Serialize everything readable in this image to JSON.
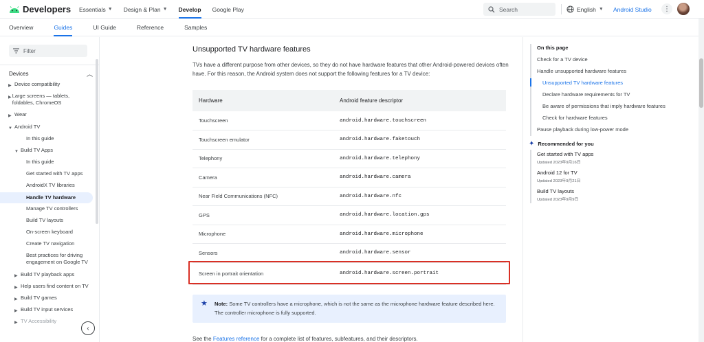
{
  "header": {
    "brand": "Developers",
    "nav": [
      {
        "label": "Essentials",
        "dropdown": true
      },
      {
        "label": "Design & Plan",
        "dropdown": true
      },
      {
        "label": "Develop",
        "dropdown": false,
        "active": true
      },
      {
        "label": "Google Play",
        "dropdown": false
      }
    ],
    "search_placeholder": "Search",
    "language": "English",
    "studio_link": "Android Studio"
  },
  "subnav": {
    "tabs": [
      {
        "label": "Overview"
      },
      {
        "label": "Guides",
        "active": true
      },
      {
        "label": "UI Guide"
      },
      {
        "label": "Reference"
      },
      {
        "label": "Samples"
      }
    ]
  },
  "sidebar": {
    "filter_placeholder": "Filter",
    "section": "Devices",
    "items": [
      {
        "label": "Device compatibility",
        "arrow": "right"
      },
      {
        "label": "Large screens — tablets, foldables, ChromeOS",
        "arrow": "right"
      },
      {
        "label": "Wear",
        "arrow": "right"
      },
      {
        "label": "Android TV",
        "arrow": "down"
      },
      {
        "label": "In this guide",
        "arrow": ""
      },
      {
        "label": "Build TV Apps",
        "arrow": "down"
      },
      {
        "label": "In this guide",
        "arrow": ""
      },
      {
        "label": "Get started with TV apps",
        "arrow": ""
      },
      {
        "label": "AndroidX TV libraries",
        "arrow": ""
      },
      {
        "label": "Handle TV hardware",
        "arrow": "",
        "active": true
      },
      {
        "label": "Manage TV controllers",
        "arrow": ""
      },
      {
        "label": "Build TV layouts",
        "arrow": ""
      },
      {
        "label": "On-screen keyboard",
        "arrow": ""
      },
      {
        "label": "Create TV navigation",
        "arrow": ""
      },
      {
        "label": "Best practices for driving engagement on Google TV",
        "arrow": ""
      },
      {
        "label": "Build TV playback apps",
        "arrow": "right"
      },
      {
        "label": "Help users find content on TV",
        "arrow": "right"
      },
      {
        "label": "Build TV games",
        "arrow": "right"
      },
      {
        "label": "Build TV input services",
        "arrow": "right"
      },
      {
        "label": "TV Accessibility",
        "arrow": "right",
        "muted": true
      }
    ]
  },
  "content": {
    "heading": "Unsupported TV hardware features",
    "intro": "TVs have a different purpose from other devices, so they do not have hardware features that other Android-powered devices often have. For this reason, the Android system does not support the following features for a TV device:",
    "table": {
      "headers": [
        "Hardware",
        "Android feature descriptor"
      ],
      "rows": [
        [
          "Touchscreen",
          "android.hardware.touchscreen"
        ],
        [
          "Touchscreen emulator",
          "android.hardware.faketouch"
        ],
        [
          "Telephony",
          "android.hardware.telephony"
        ],
        [
          "Camera",
          "android.hardware.camera"
        ],
        [
          "Near Field Communications (NFC)",
          "android.hardware.nfc"
        ],
        [
          "GPS",
          "android.hardware.location.gps"
        ],
        [
          "Microphone",
          "android.hardware.microphone"
        ],
        [
          "Sensors",
          "android.hardware.sensor"
        ],
        [
          "Screen in portrait orientation",
          "android.hardware.screen.portrait"
        ]
      ]
    },
    "note_label": "Note:",
    "note_text": " Some TV controllers have a microphone, which is not the same as the microphone hardware feature described here. The controller microphone is fully supported.",
    "see_prefix": "See the ",
    "see_link": "Features reference",
    "see_suffix": " for a complete list of features, subfeatures, and their descriptors."
  },
  "toc": {
    "heading": "On this page",
    "items": [
      {
        "label": "Check for a TV device",
        "level": 1
      },
      {
        "label": "Handle unsupported hardware features",
        "level": 1
      },
      {
        "label": "Unsupported TV hardware features",
        "level": 2,
        "active": true
      },
      {
        "label": "Declare hardware requirements for TV",
        "level": 2
      },
      {
        "label": "Be aware of permissions that imply hardware features",
        "level": 2
      },
      {
        "label": "Check for hardware features",
        "level": 2
      },
      {
        "label": "Pause playback during low-power mode",
        "level": 1
      }
    ],
    "recommended_heading": "Recommended for you",
    "recommended": [
      {
        "title": "Get started with TV apps",
        "date": "Updated 2023年9月16日"
      },
      {
        "title": "Android 12 for TV",
        "date": "Updated 2023年9月21日"
      },
      {
        "title": "Build TV layouts",
        "date": "Updated 2023年9月9日"
      }
    ]
  },
  "colors": {
    "accent": "#1a73e8",
    "highlight": "#d93025",
    "note_bg": "#e8f0fe"
  }
}
